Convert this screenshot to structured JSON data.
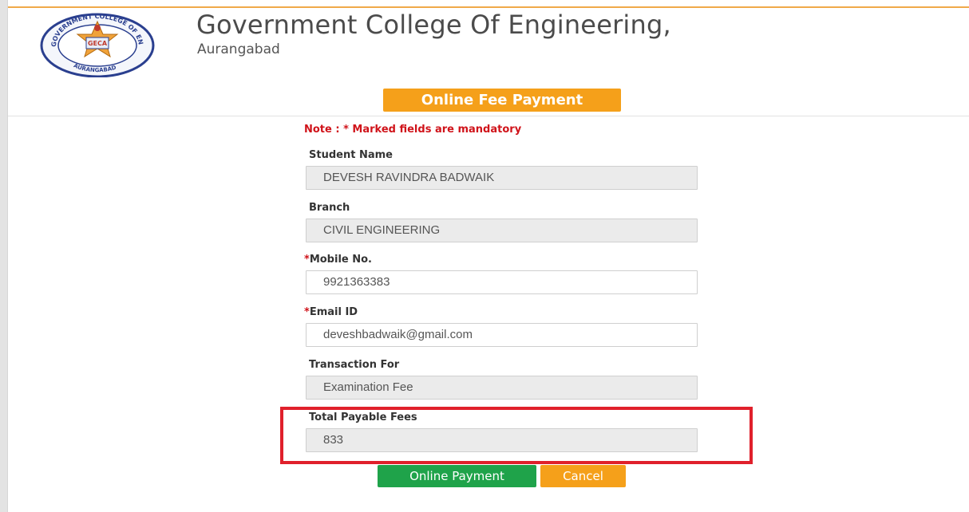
{
  "header": {
    "logo_text_top": "GOVERNMENT COLLEGE OF ENGINEERING",
    "logo_text_bottom": "AURANGABAD",
    "logo_abbrev": "GECA",
    "college_name": "Government College Of Engineering,",
    "college_city": "Aurangabad"
  },
  "banner": {
    "label": "Online Fee Payment"
  },
  "note": "Note : * Marked fields are mandatory",
  "form": {
    "student_name": {
      "label": "Student Name",
      "value": "DEVESH RAVINDRA BADWAIK"
    },
    "branch": {
      "label": "Branch",
      "value": "CIVIL ENGINEERING"
    },
    "mobile": {
      "required_mark": "*",
      "label": "Mobile No.",
      "value": "9921363383"
    },
    "email": {
      "required_mark": "*",
      "label": "Email ID",
      "value": "deveshbadwaik@gmail.com"
    },
    "transaction_for": {
      "label": "Transaction For",
      "value": "Examination Fee"
    },
    "total_fees": {
      "label": "Total Payable Fees",
      "value": "833"
    }
  },
  "buttons": {
    "pay_label": "Online Payment",
    "cancel_label": "Cancel"
  },
  "colors": {
    "accent_orange": "#f5a01a",
    "required_red": "#d0131a",
    "pay_green": "#1fa34a",
    "highlight_red": "#e0202b"
  }
}
